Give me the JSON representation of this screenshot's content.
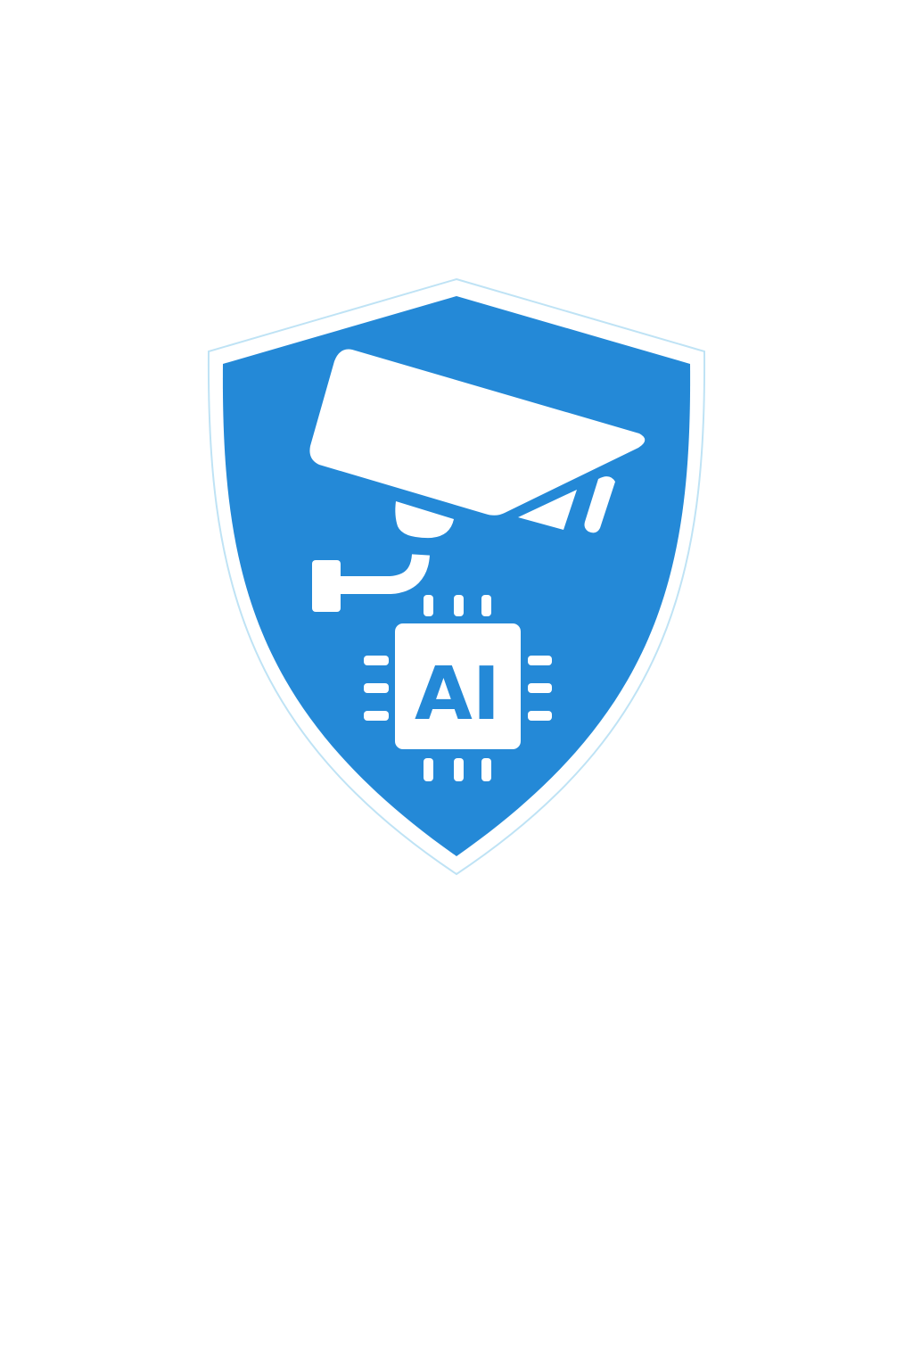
{
  "logo": {
    "chip_text": "AI",
    "shield_color": "#2489D7",
    "shield_outline_color": "#BFE3F5",
    "foreground_color": "#FFFFFF",
    "icons": [
      "shield-icon",
      "security-camera-icon",
      "ai-chip-icon"
    ]
  }
}
